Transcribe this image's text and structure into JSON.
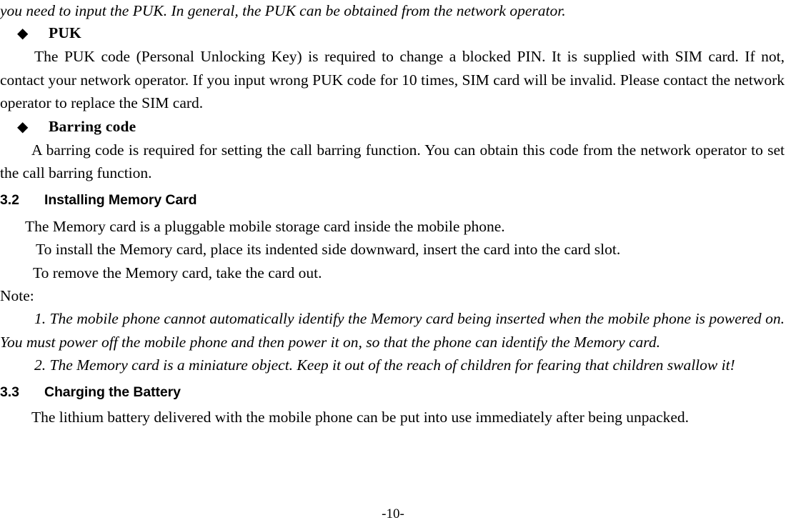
{
  "document": {
    "page_number": "-10-",
    "blocks": [
      {
        "id": "continuation",
        "kind": "paragraph-continuation",
        "style": "italic",
        "text": "you need to input the PUK. In general, the PUK can be obtained from the network operator."
      },
      {
        "id": "bullet-puk",
        "kind": "bullet-heading",
        "marker": "diamond-bullet",
        "marker_glyph": "◆",
        "label": "PUK"
      },
      {
        "id": "para-puk",
        "kind": "paragraph",
        "style": "roman",
        "text": "The PUK code (Personal Unlocking Key) is required to change a blocked PIN. It is supplied with SIM card. If not, contact your network operator. If you input wrong PUK code for 10 times, SIM card will be invalid. Please contact the network operator to replace the SIM card."
      },
      {
        "id": "bullet-barring",
        "kind": "bullet-heading",
        "marker": "diamond-bullet",
        "marker_glyph": "◆",
        "label": "Barring code"
      },
      {
        "id": "para-barring",
        "kind": "paragraph",
        "style": "roman",
        "text": "A barring code is required for setting the call barring function. You can obtain this code from the network operator to set the call barring function."
      },
      {
        "id": "section-3-2",
        "kind": "section-heading",
        "number": "3.2",
        "title": "Installing Memory Card"
      },
      {
        "id": "line-memory-1",
        "kind": "line",
        "text": "The Memory card is a pluggable mobile storage card inside the mobile phone."
      },
      {
        "id": "line-memory-2",
        "kind": "line",
        "text": "To install the Memory card, place its indented side downward, insert the card into the card slot."
      },
      {
        "id": "line-memory-3",
        "kind": "line",
        "text": "To remove the Memory card, take the card out."
      },
      {
        "id": "note-label",
        "kind": "label",
        "text": "Note:"
      },
      {
        "id": "note-1",
        "kind": "paragraph",
        "style": "italic",
        "text": "1. The mobile phone cannot automatically identify the Memory card being inserted when the mobile phone is powered on. You must power off the mobile phone and then power it on, so that the phone can identify the Memory card."
      },
      {
        "id": "note-2",
        "kind": "paragraph",
        "style": "italic",
        "text": "2. The Memory card is a miniature object. Keep it out of the reach of children for fearing that children swallow it!"
      },
      {
        "id": "section-3-3",
        "kind": "section-heading",
        "number": "3.3",
        "title": "Charging the Battery"
      },
      {
        "id": "para-battery",
        "kind": "paragraph",
        "style": "roman",
        "text": "The lithium battery delivered with the mobile phone can be put into use immediately after being unpacked."
      }
    ]
  }
}
